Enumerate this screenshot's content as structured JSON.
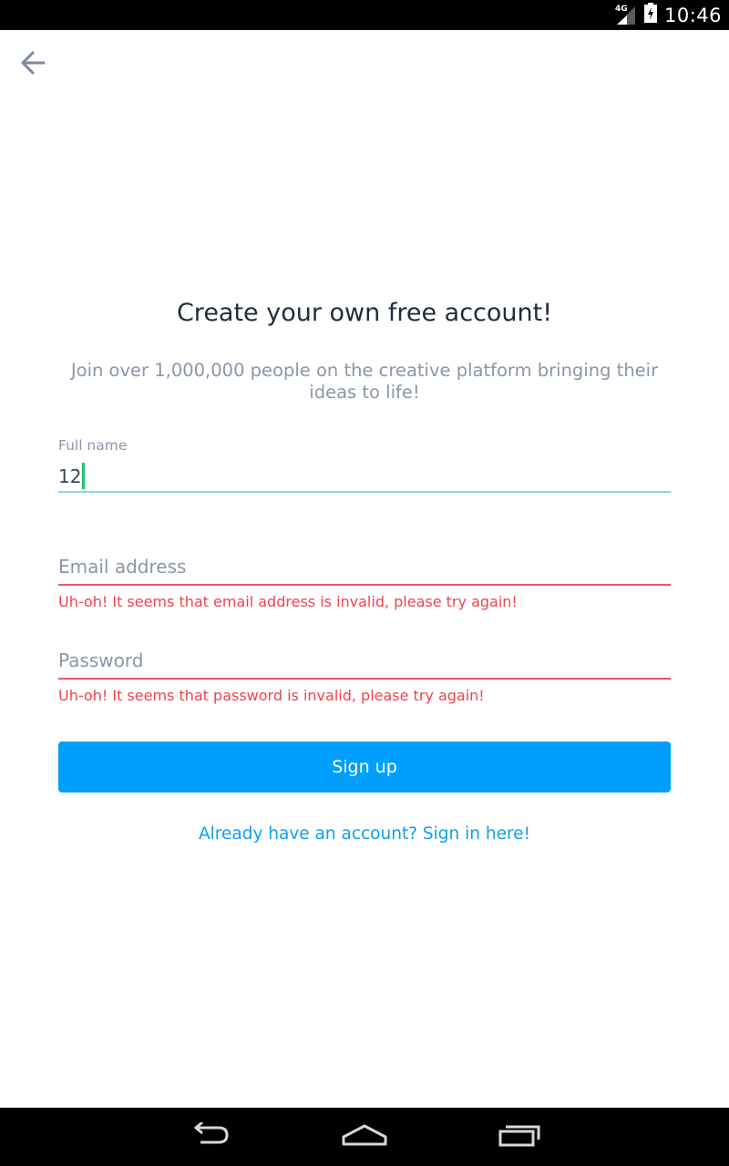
{
  "status_bar": {
    "network_type": "4G",
    "time": "10:46",
    "icons": [
      "signal-icon",
      "battery-icon"
    ]
  },
  "header": {
    "back_icon": "arrow-left-icon"
  },
  "signup": {
    "title": "Create your own free account!",
    "subtitle": "Join over 1,000,000 people on the creative platform bringing their ideas to life!",
    "full_name": {
      "label": "Full name",
      "value": "12"
    },
    "email": {
      "placeholder": "Email address",
      "value": "",
      "error": "Uh-oh! It seems that email address is invalid, please try again!"
    },
    "password": {
      "placeholder": "Password",
      "value": "",
      "error": "Uh-oh! It seems that password is invalid, please try again!"
    },
    "submit_label": "Sign up",
    "signin_link": "Already have an account? Sign in here!"
  },
  "colors": {
    "accent": "#009ffe",
    "error": "#f0434e",
    "focus_underline": "#8fd2f5",
    "cursor": "#1fc26a",
    "title": "#1f2d3d",
    "muted": "#8a96a8"
  },
  "nav_bar": {
    "icons": [
      "back-nav-icon",
      "home-nav-icon",
      "recents-nav-icon"
    ]
  }
}
